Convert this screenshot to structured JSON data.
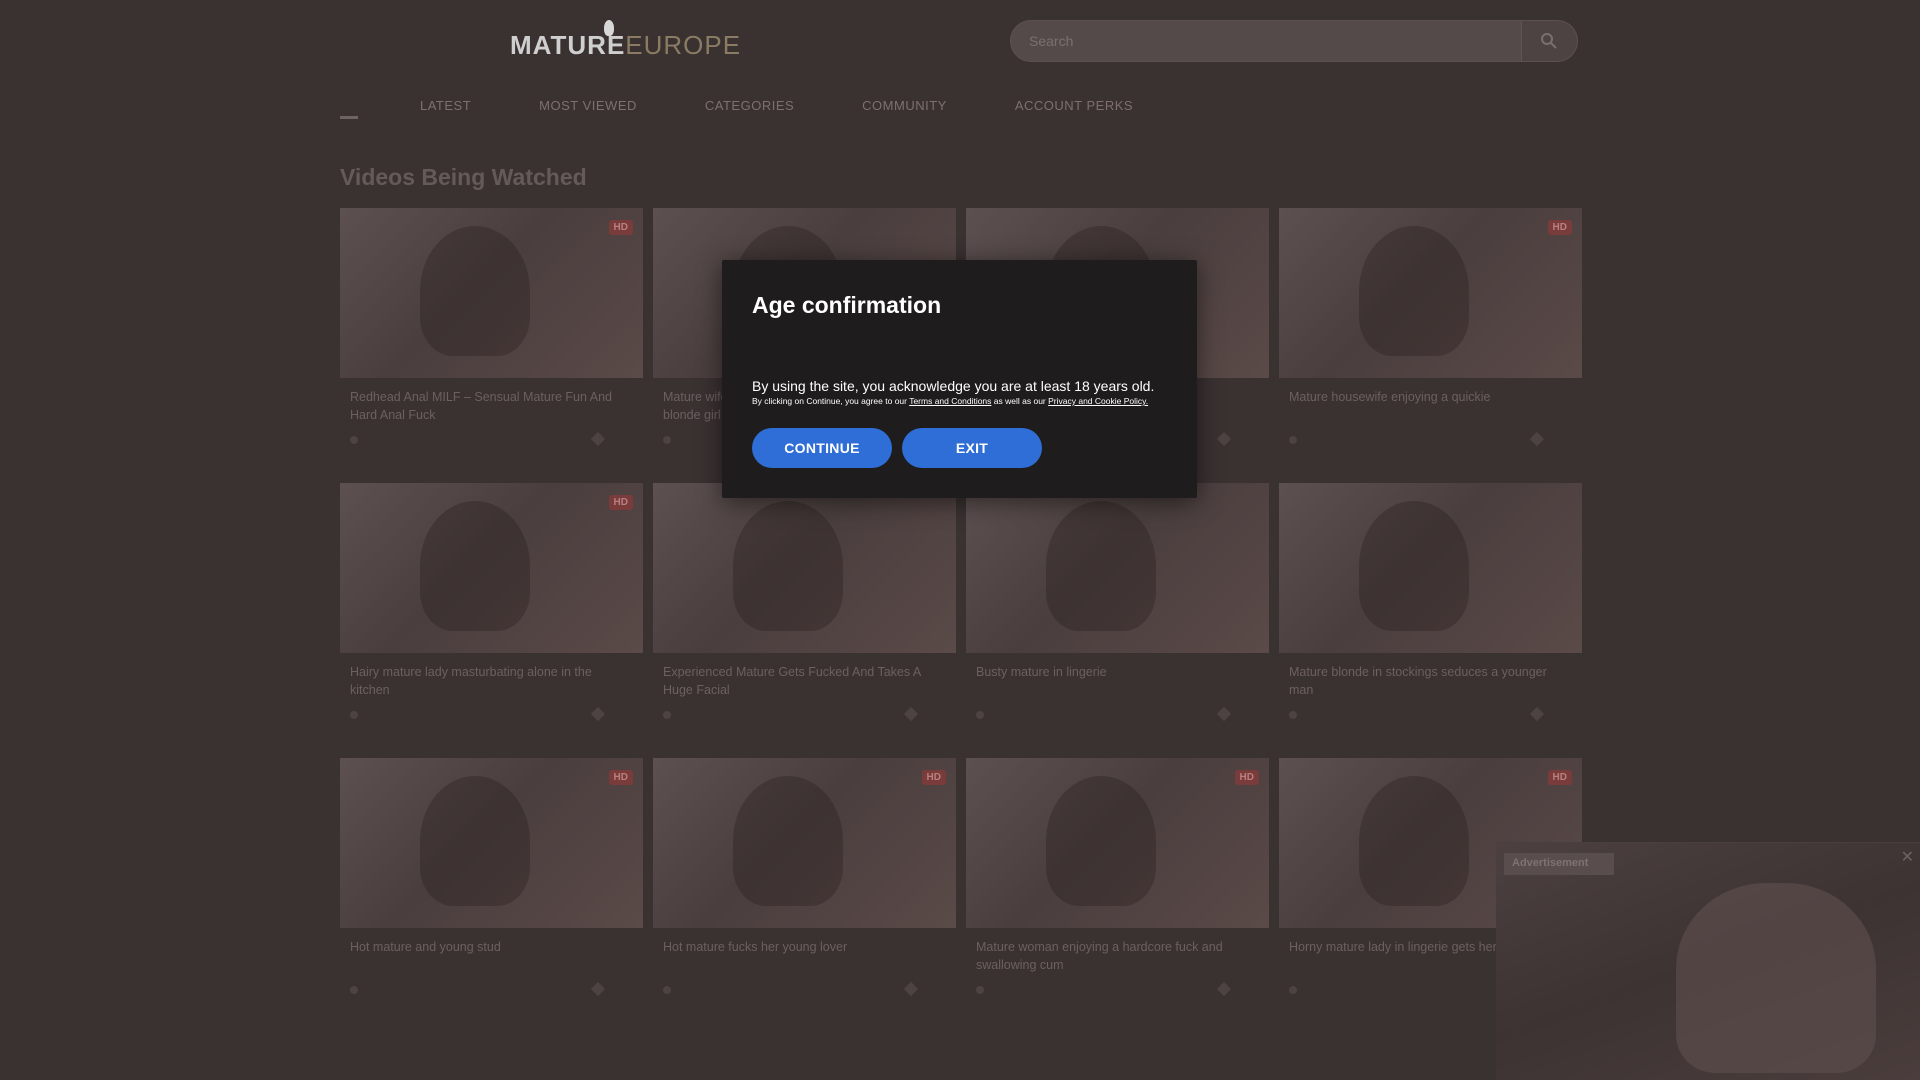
{
  "site": {
    "logo_part1": "MATURE",
    "logo_part2": "EUROPE",
    "search_placeholder": "Search",
    "nav": [
      "LATEST",
      "MOST VIEWED",
      "CATEGORIES",
      "COMMUNITY",
      "ACCOUNT PERKS"
    ],
    "section_title": "Videos Being Watched",
    "badge": "HD"
  },
  "videos": [
    {
      "title": "Redhead Anal MILF – Sensual Mature Fun And Hard Anal Fuck",
      "badge": "HD"
    },
    {
      "title": "Mature wife shares her husband with a younger blonde girl",
      "badge": ""
    },
    {
      "title": "",
      "badge": ""
    },
    {
      "title": "Mature housewife enjoying a quickie",
      "badge": "HD"
    },
    {
      "title": "Hairy mature lady masturbating alone in the kitchen",
      "badge": "HD"
    },
    {
      "title": "Experienced Mature Gets Fucked And Takes A Huge Facial",
      "badge": ""
    },
    {
      "title": "Busty mature in lingerie",
      "badge": ""
    },
    {
      "title": "Mature blonde in stockings seduces a younger man",
      "badge": ""
    },
    {
      "title": "Hot mature and young stud",
      "badge": "HD"
    },
    {
      "title": "Hot mature fucks her young lover",
      "badge": "HD"
    },
    {
      "title": "Mature woman enjoying a hardcore fuck and swallowing cum",
      "badge": "HD"
    },
    {
      "title": "Horny mature lady in lingerie gets her pussy eaten",
      "badge": "HD"
    }
  ],
  "miniplayer": {
    "label": "Advertisement",
    "close": "✕"
  },
  "modal": {
    "title": "Age confirmation",
    "main_text": "By using the site, you acknowledge you are at least 18 years old.",
    "sub_prefix": "By clicking on Continue, you agree to our ",
    "terms_link": "Terms and Conditions",
    "sub_middle": " as well as our ",
    "privacy_link": "Privacy and Cookie Policy.",
    "continue_label": "CONTINUE",
    "exit_label": "EXIT",
    "button_color": "#2e6ed6"
  }
}
